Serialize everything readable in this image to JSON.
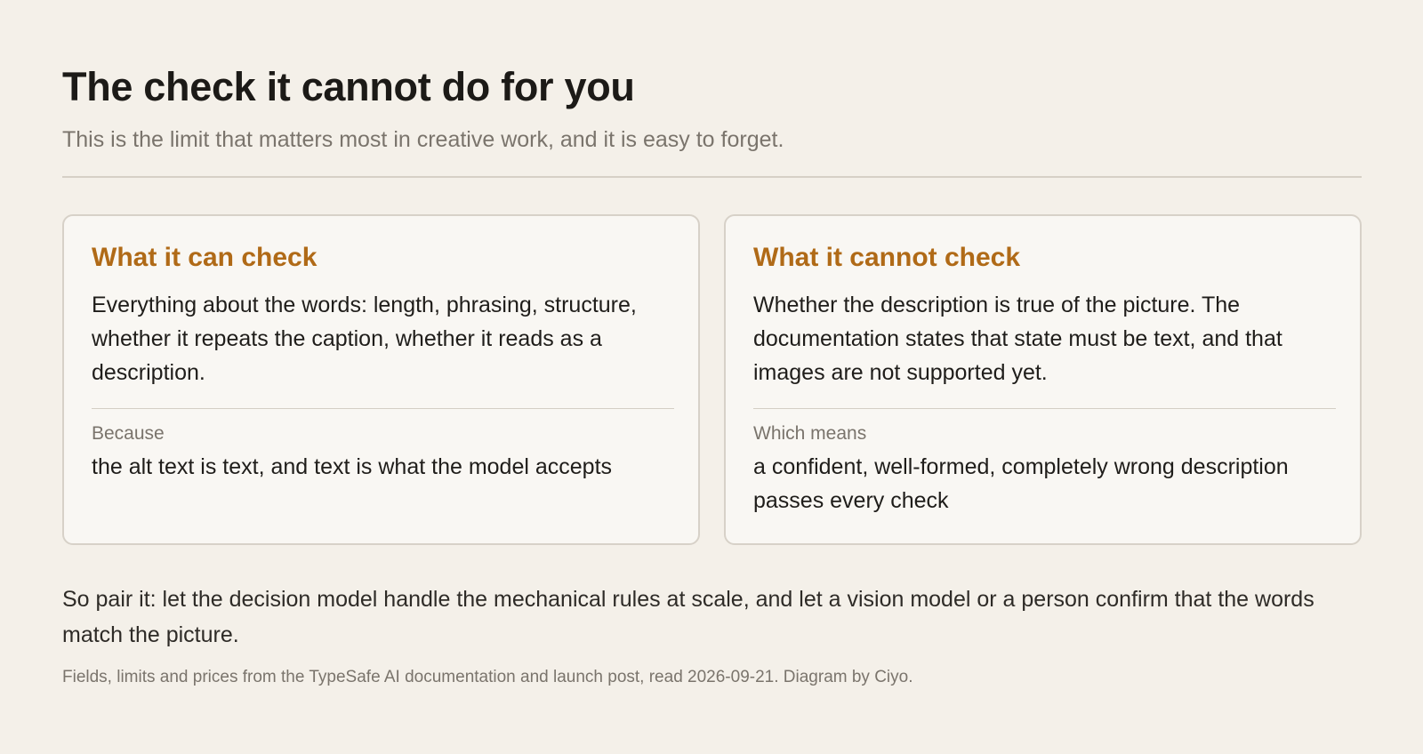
{
  "header": {
    "title": "The check it cannot do for you",
    "subtitle": "This is the limit that matters most in creative work, and it is easy to forget."
  },
  "cards": [
    {
      "heading": "What it can check",
      "body": "Everything about the words: length, phrasing, structure, whether it repeats the caption, whether it reads as a description.",
      "sublabel": "Because",
      "subtext": "the alt text is text, and text is what the model accepts"
    },
    {
      "heading": "What it cannot check",
      "body": "Whether the description is true of the picture. The documentation states that state must be text, and that images are not supported yet.",
      "sublabel": "Which means",
      "subtext": "a confident, well-formed, completely wrong description passes every check"
    }
  ],
  "conclusion": "So pair it: let the decision model handle the mechanical rules at scale, and let a vision model or a person confirm that the words match the picture.",
  "footnote": "Fields, limits and prices from the TypeSafe AI documentation and launch post, read 2026-09-21. Diagram by Ciyo.",
  "colors": {
    "background": "#f4f0e9",
    "card_background": "#f9f7f3",
    "accent": "#b06a17",
    "muted_text": "#7a746c"
  }
}
